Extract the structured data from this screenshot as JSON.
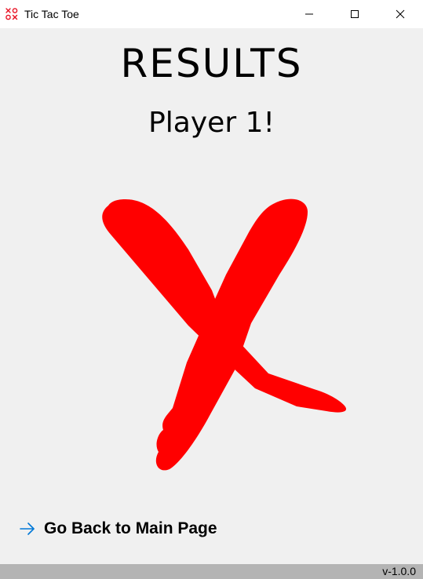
{
  "window": {
    "title": "Tic Tac Toe",
    "icon": "xo-app-icon",
    "controls": [
      "minimize-icon",
      "maximize-icon",
      "close-icon"
    ]
  },
  "results": {
    "heading": "RESULTS",
    "winner": "Player 1!",
    "winner_symbol": "X",
    "winner_color": "#ff0000"
  },
  "navigation": {
    "back_label": "Go Back to Main Page",
    "back_icon": "arrow-right-icon",
    "accent": "#0078d7"
  },
  "status": {
    "version": "v-1.0.0"
  }
}
